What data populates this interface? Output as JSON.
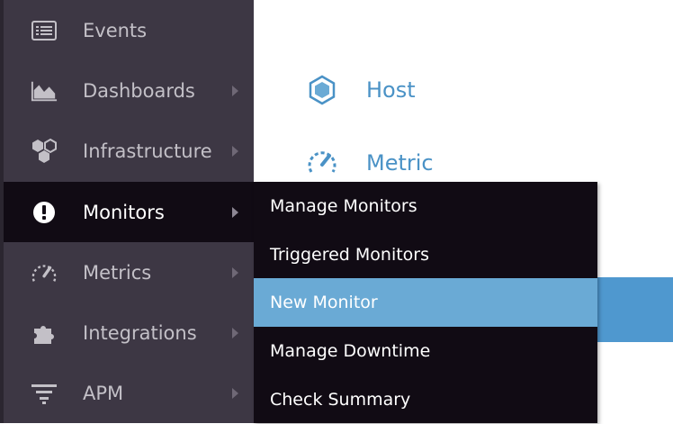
{
  "sidebar": {
    "items": [
      {
        "label": "Events",
        "icon": "list-icon",
        "has_submenu": false
      },
      {
        "label": "Dashboards",
        "icon": "area-chart-icon",
        "has_submenu": true
      },
      {
        "label": "Infrastructure",
        "icon": "hexagons-icon",
        "has_submenu": true
      },
      {
        "label": "Monitors",
        "icon": "alert-circle-icon",
        "has_submenu": true,
        "active": true
      },
      {
        "label": "Metrics",
        "icon": "gauge-icon",
        "has_submenu": true
      },
      {
        "label": "Integrations",
        "icon": "puzzle-icon",
        "has_submenu": true
      },
      {
        "label": "APM",
        "icon": "filter-icon",
        "has_submenu": true
      }
    ]
  },
  "submenu": {
    "items": [
      {
        "label": "Manage Monitors"
      },
      {
        "label": "Triggered Monitors"
      },
      {
        "label": "New Monitor",
        "highlighted": true
      },
      {
        "label": "Manage Downtime"
      },
      {
        "label": "Check Summary"
      }
    ]
  },
  "content": {
    "items": [
      {
        "label": "Host",
        "icon": "hexagon-icon"
      },
      {
        "label": "Metric",
        "icon": "gauge-icon"
      }
    ]
  },
  "colors": {
    "sidebar_bg": "#3d3744",
    "active_bg": "#110b14",
    "highlight": "#6aaad5",
    "link": "#4a92c6"
  }
}
